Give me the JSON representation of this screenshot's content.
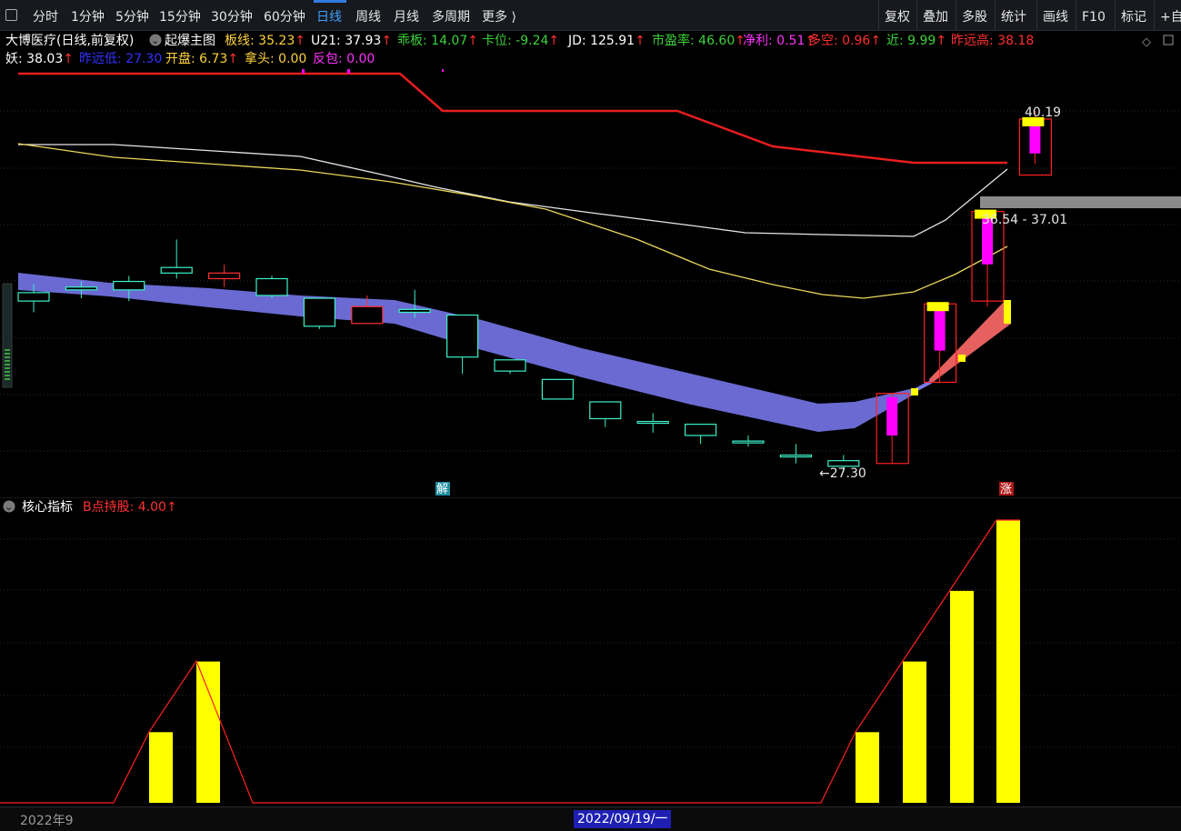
{
  "toolbar": {
    "items": [
      "分时",
      "1分钟",
      "5分钟",
      "15分钟",
      "30分钟",
      "60分钟",
      "日线",
      "周线",
      "月线",
      "多周期",
      "更多 ⟩"
    ],
    "active": "日线",
    "right_items": [
      "复权",
      "叠加",
      "多股",
      "统计",
      "画线",
      "F10",
      "标记",
      "+自"
    ]
  },
  "main_header": {
    "stock": "大博医疗(日线,前复权)",
    "indicator": "起爆主图",
    "row1": [
      {
        "label": "板线: 35.23",
        "color": "#ffd23c",
        "arrow": "↑"
      },
      {
        "label": "U21: 37.93",
        "color": "#ffffff",
        "arrow": "↑"
      },
      {
        "label": "乖板: 14.07",
        "color": "#3cd23c",
        "arrow": "↑"
      },
      {
        "label": "卡位: -9.24",
        "color": "#3cd23c",
        "arrow": "↑"
      },
      {
        "label": "JD: 125.91",
        "color": "#ffffff",
        "arrow": "↑"
      },
      {
        "label": "市盈率: 46.60",
        "color": "#3cd23c",
        "arrow": "↑"
      },
      {
        "label": "净利: 0.51",
        "color": "#ff32ff",
        "arrow": "↑"
      },
      {
        "label": "多空: 0.96",
        "color": "#ff3030",
        "arrow": "↑"
      },
      {
        "label": "近: 9.99",
        "color": "#3cd23c",
        "arrow": "↑"
      },
      {
        "label": "昨远高: 38.18",
        "color": "#ff3030",
        "arrow": ""
      }
    ],
    "row2": [
      {
        "label": "妖: 38.03",
        "color": "#ffffff",
        "arrow": "↑"
      },
      {
        "label": "昨远低: 27.30",
        "color": "#3232ff",
        "arrow": ""
      },
      {
        "label": "开盘: 6.73",
        "color": "#ffd23c",
        "arrow": "↑"
      },
      {
        "label": "拿头: 0.00",
        "color": "#ffd23c",
        "arrow": ""
      },
      {
        "label": "反包: 0.00",
        "color": "#ff32ff",
        "arrow": ""
      }
    ]
  },
  "annotations": {
    "high_price": "40.19",
    "price_range": "36.54 - 37.01",
    "low_price": "←27.30",
    "marker_jie": "解",
    "marker_zhang": "涨"
  },
  "sub_header": {
    "indicator": "核心指标",
    "value_label": "B点持股: 4.00",
    "arrow": "↑"
  },
  "date_bar": {
    "left": "2022年9",
    "cursor": "2022/09/19/一"
  },
  "colors": {
    "up": "#ff3030",
    "down": "#3cf0c8",
    "ribbon": "#6a6ad2",
    "ma_white": "#e6e6e6",
    "ma_yellow": "#ebd75a",
    "red_line": "#e61e1e",
    "bar_yellow": "#ffff00",
    "magenta": "#ff00ff"
  },
  "chart_data": {
    "type": "candlestick",
    "price_scale": {
      "high": 40.19,
      "low": 27.3
    },
    "candles": [
      {
        "o": 33.7,
        "c": 33.4,
        "h": 34.0,
        "l": 33.0
      },
      {
        "o": 33.9,
        "c": 33.8,
        "h": 34.1,
        "l": 33.5
      },
      {
        "o": 34.1,
        "c": 33.8,
        "h": 34.3,
        "l": 33.4
      },
      {
        "o": 34.6,
        "c": 34.4,
        "h": 35.6,
        "l": 34.2
      },
      {
        "o": 34.2,
        "c": 34.4,
        "h": 34.7,
        "l": 33.9
      },
      {
        "o": 34.2,
        "c": 33.6,
        "h": 34.3,
        "l": 33.5
      },
      {
        "o": 33.5,
        "c": 32.5,
        "h": 33.5,
        "l": 32.4
      },
      {
        "o": 32.6,
        "c": 33.2,
        "h": 33.6,
        "l": 32.6
      },
      {
        "o": 33.1,
        "c": 33.0,
        "h": 33.8,
        "l": 32.8
      },
      {
        "o": 32.9,
        "c": 31.4,
        "h": 32.9,
        "l": 30.8
      },
      {
        "o": 31.3,
        "c": 30.9,
        "h": 31.3,
        "l": 30.8
      },
      {
        "o": 30.6,
        "c": 29.9,
        "h": 30.6,
        "l": 29.9
      },
      {
        "o": 29.8,
        "c": 29.2,
        "h": 29.8,
        "l": 28.9
      },
      {
        "o": 29.1,
        "c": 29.1,
        "h": 29.4,
        "l": 28.7
      },
      {
        "o": 29.0,
        "c": 28.6,
        "h": 29.0,
        "l": 28.3
      },
      {
        "o": 28.4,
        "c": 28.4,
        "h": 28.6,
        "l": 28.2
      },
      {
        "o": 27.9,
        "c": 27.9,
        "h": 28.3,
        "l": 27.6
      },
      {
        "o": 27.7,
        "c": 27.5,
        "h": 27.9,
        "l": 27.3
      },
      {
        "o": 27.6,
        "c": 30.1,
        "h": 30.1,
        "l": 27.6
      },
      {
        "o": 30.5,
        "c": 33.3,
        "h": 33.3,
        "l": 30.5
      },
      {
        "o": 33.4,
        "c": 36.6,
        "h": 36.6,
        "l": 33.2
      },
      {
        "o": 37.9,
        "c": 39.9,
        "h": 40.19,
        "l": 38.3
      }
    ],
    "core_indicator": {
      "name": "B点持股",
      "bars": [
        {
          "index": 3,
          "value": 1
        },
        {
          "index": 4,
          "value": 2
        },
        {
          "index": 18,
          "value": 1
        },
        {
          "index": 19,
          "value": 2
        },
        {
          "index": 20,
          "value": 3
        },
        {
          "index": 21,
          "value": 4
        }
      ]
    }
  }
}
